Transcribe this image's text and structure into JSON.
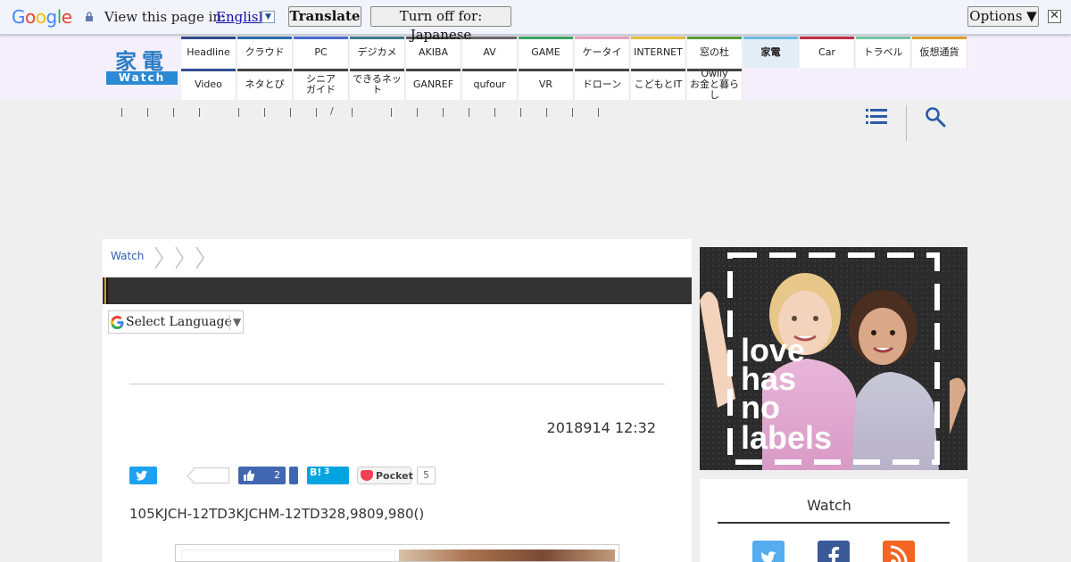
{
  "translate_bar": {
    "logo": [
      "G",
      "o",
      "o",
      "g",
      "l",
      "e"
    ],
    "view_label": "View this page in:",
    "language": "English",
    "translate_button": "Translate",
    "turn_off_button": "Turn off for: Japanese",
    "options_button": "Options ▼",
    "close_glyph": "✕"
  },
  "site": {
    "logo_kanji": "家電",
    "logo_sub": "Watch"
  },
  "nav": {
    "row1": [
      {
        "label": "Headline",
        "color": "#2f4f8f"
      },
      {
        "label": "クラウド",
        "color": "#2b6fa8"
      },
      {
        "label": "PC",
        "color": "#4a6fd1"
      },
      {
        "label": "デジカメ",
        "color": "#3a7d8c"
      },
      {
        "label": "AKIBA",
        "color": "#555555"
      },
      {
        "label": "AV",
        "color": "#6a6a6a"
      },
      {
        "label": "GAME",
        "color": "#3aa866"
      },
      {
        "label": "ケータイ",
        "color": "#e7a6c3"
      },
      {
        "label": "INTERNET",
        "color": "#e8c23a"
      },
      {
        "label": "窓の杜",
        "color": "#5aa03a"
      },
      {
        "label": "家電",
        "color": "#6cc0e8",
        "active": true
      },
      {
        "label": "Car",
        "color": "#c0304a"
      },
      {
        "label": "トラベル",
        "color": "#7ac8a8"
      },
      {
        "label": "仮想通貨",
        "color": "#e0a030"
      }
    ],
    "row2": [
      {
        "label": "Video",
        "color": "#2f4f8f"
      },
      {
        "label": "ネタとぴ",
        "color": "#444444"
      },
      {
        "label": "シニア\nガイド",
        "color": "#444444"
      },
      {
        "label": "できるネット",
        "color": "#444444"
      },
      {
        "label": "GANREF",
        "color": "#444444"
      },
      {
        "label": "qufour",
        "color": "#444444"
      },
      {
        "label": "VR",
        "color": "#444444"
      },
      {
        "label": "ドローン",
        "color": "#444444"
      },
      {
        "label": "こどもとIT",
        "color": "#444444"
      },
      {
        "label": "Owlly\nお金と暮らし",
        "color": "#444444"
      }
    ]
  },
  "crumbs_slash": "/",
  "breadcrumb": {
    "label": "Watch"
  },
  "select_language": "Select Language",
  "article": {
    "timestamp": "2018914 12:32",
    "lead": "105KJCH-12TD3KJCHM-12TD328,9809,980()"
  },
  "share": {
    "facebook_count": "2",
    "hatena_label": "B!",
    "hatena_count": "3",
    "pocket_label": "Pocket",
    "pocket_count": "5"
  },
  "ad": {
    "tagline": [
      "love",
      "has",
      "no",
      "labels"
    ]
  },
  "sidebar": {
    "watch_title": "Watch"
  },
  "colors": {
    "twitter": "#1da1f2",
    "facebook": "#4267b2",
    "hatena": "#00a4de",
    "pocket": "#ef4056",
    "rss": "#f26522"
  }
}
